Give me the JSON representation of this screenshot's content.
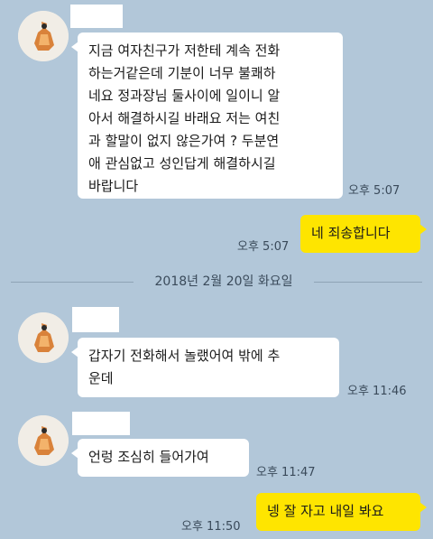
{
  "messages": [
    {
      "text": "지금 여자친구가 저한테 계속 전화\n하는거같은데 기분이 너무 불쾌하\n네요 정과장님 둘사이에 일이니 알\n아서 해결하시길 바래요 저는 여친\n과 할말이 없지 않은가여 ? 두분연\n애 관심없고 성인답게 해결하시길\n바랍니다",
      "time": "오후 5:07"
    },
    {
      "text": "네 죄송합니다",
      "time": "오후 5:07"
    },
    {
      "text": "갑자기 전화해서 놀랬어여 밖에 추\n운데",
      "time": "오후 11:46"
    },
    {
      "text": "언렁 조심히 들어가여",
      "time": "오후 11:47"
    },
    {
      "text": "넹 잘 자고 내일 봐요",
      "time": "오후 11:50"
    }
  ],
  "date_divider": "2018년 2월 20일 화요일",
  "colors": {
    "background": "#b2c7d9",
    "my_bubble": "#fee500",
    "their_bubble": "#ffffff"
  }
}
